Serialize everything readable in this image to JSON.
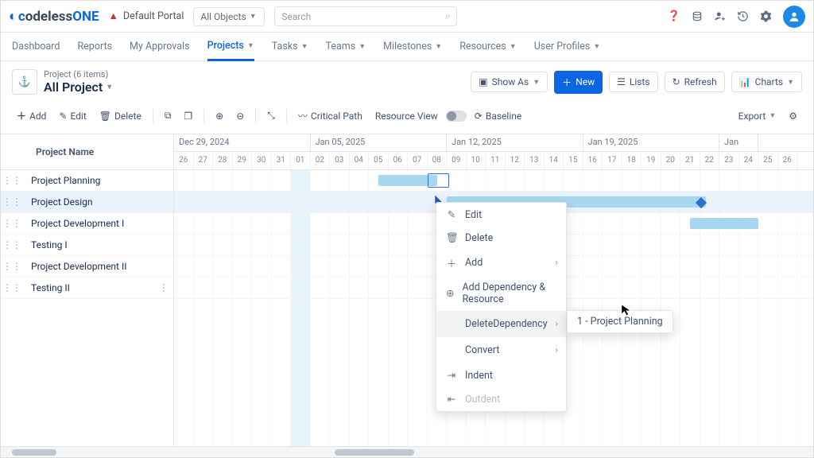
{
  "header": {
    "logo_c": "c",
    "logo_mid": "odeless",
    "logo_one": "ONE",
    "portal_label": "Default Portal",
    "object_select": "All Objects",
    "search_placeholder": "Search"
  },
  "nav": [
    {
      "label": "Dashboard",
      "dd": false
    },
    {
      "label": "Reports",
      "dd": false
    },
    {
      "label": "My Approvals",
      "dd": false
    },
    {
      "label": "Projects",
      "dd": true,
      "active": true
    },
    {
      "label": "Tasks",
      "dd": true
    },
    {
      "label": "Teams",
      "dd": true
    },
    {
      "label": "Milestones",
      "dd": true
    },
    {
      "label": "Resources",
      "dd": true
    },
    {
      "label": "User Profiles",
      "dd": true
    }
  ],
  "breadcrumb": {
    "crumb": "Project (6 items)",
    "title": "All Project"
  },
  "actions": {
    "show_as": "Show As",
    "new": "New",
    "lists": "Lists",
    "refresh": "Refresh",
    "charts": "Charts"
  },
  "toolbar": {
    "add": "Add",
    "edit": "Edit",
    "delete": "Delete",
    "critical": "Critical Path",
    "resource": "Resource View",
    "baseline": "Baseline",
    "export": "Export"
  },
  "task_header": "Project Name",
  "weeks": [
    {
      "label": "Dec 29, 2024",
      "span": 7
    },
    {
      "label": "Jan 05, 2025",
      "span": 7
    },
    {
      "label": "Jan 12, 2025",
      "span": 7
    },
    {
      "label": "Jan 19, 2025",
      "span": 7
    },
    {
      "label": "Jan",
      "span": 2
    }
  ],
  "days": [
    "26",
    "27",
    "28",
    "29",
    "30",
    "31",
    "01",
    "02",
    "03",
    "04",
    "05",
    "06",
    "07",
    "08",
    "09",
    "10",
    "11",
    "12",
    "13",
    "14",
    "15",
    "16",
    "17",
    "18",
    "19",
    "20",
    "21",
    "22",
    "23",
    "24",
    "25",
    "26"
  ],
  "today_index": 6,
  "tasks": [
    {
      "name": "Project Planning"
    },
    {
      "name": "Project Design"
    },
    {
      "name": "Project Development I"
    },
    {
      "name": "Testing I"
    },
    {
      "name": "Project Development II"
    },
    {
      "name": "Testing II"
    }
  ],
  "ctx": [
    {
      "icon": "edit",
      "label": "Edit"
    },
    {
      "icon": "trash",
      "label": "Delete"
    },
    {
      "icon": "plus",
      "label": "Add",
      "sub": true
    },
    {
      "icon": "link",
      "label": "Add Dependency & Resource"
    },
    {
      "icon": "",
      "label": "DeleteDependency",
      "sub": true,
      "hover": true
    },
    {
      "icon": "",
      "label": "Convert",
      "sub": true
    },
    {
      "icon": "indent",
      "label": "Indent"
    },
    {
      "icon": "outdent",
      "label": "Outdent",
      "disabled": true
    }
  ],
  "ctx_sub": "1 - Project Planning"
}
